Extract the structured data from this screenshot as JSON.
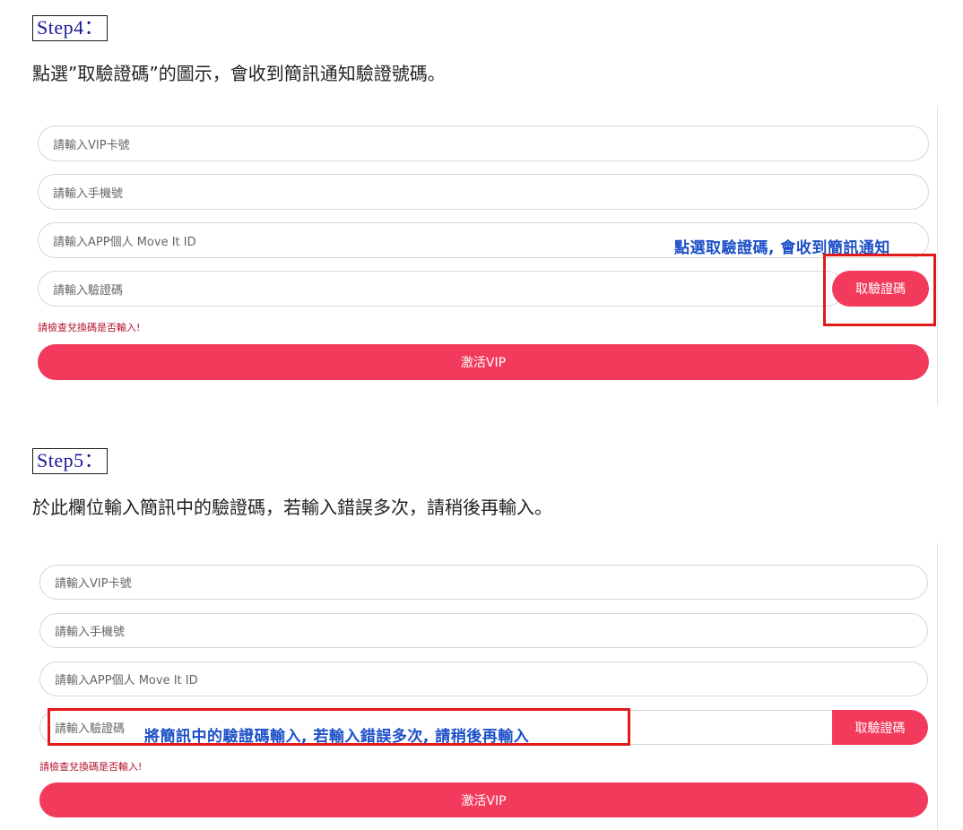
{
  "step4": {
    "label": "Step4：",
    "instruction": "點選”取驗證碼”的圖示，會收到簡訊通知驗證號碼。",
    "form": {
      "vip_placeholder": "請輸入VIP卡號",
      "phone_placeholder": "請輸入手機號",
      "app_id_placeholder": "請輸入APP個人 Move It ID",
      "code_placeholder": "請輸入驗證碼",
      "get_code_label": "取驗證碼",
      "error_text": "請檢查兌換碼是否輸入!",
      "activate_label": "激活VIP"
    },
    "annotation": "點選取驗證碼, 會收到簡訊通知"
  },
  "step5": {
    "label": "Step5：",
    "instruction": "於此欄位輸入簡訊中的驗證碼，若輸入錯誤多次，請稍後再輸入。",
    "form": {
      "vip_placeholder": "請輸入VIP卡號",
      "phone_placeholder": "請輸入手機號",
      "app_id_placeholder": "請輸入APP個人 Move It ID",
      "code_placeholder": "請輸入驗證碼",
      "get_code_label": "取驗證碼",
      "error_text": "請檢查兌換碼是否輸入!",
      "activate_label": "激活VIP"
    },
    "annotation": "將簡訊中的驗證碼輸入, 若輸入錯誤多次, 請稍後再輸入"
  },
  "colors": {
    "accent": "#f23b5c",
    "annotation_blue": "#1d50c7",
    "highlight_red": "#e01919",
    "step_label_blue": "#1a1a9a"
  }
}
